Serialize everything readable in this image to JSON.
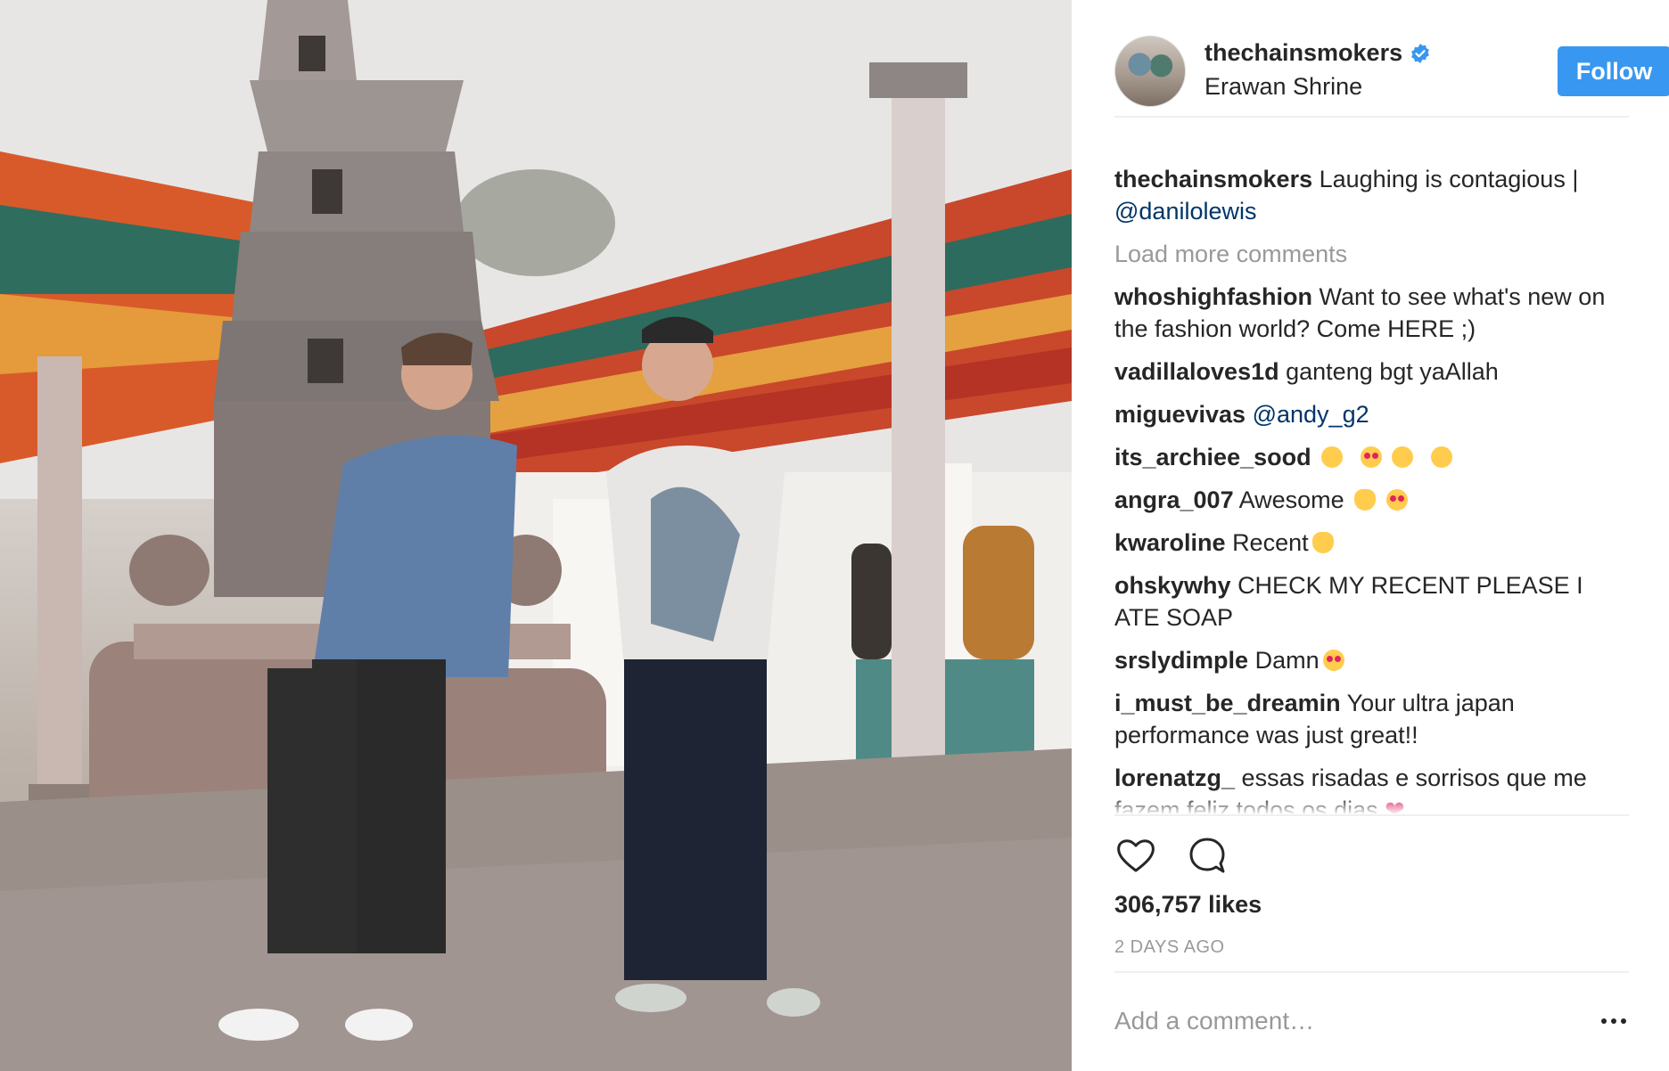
{
  "post": {
    "username": "thechainsmokers",
    "verified": true,
    "location": "Erawan Shrine",
    "follow_label": "Follow",
    "photo_alt": "",
    "accent_color": "#3897f0"
  },
  "caption": {
    "username": "thechainsmokers",
    "text": "Laughing is contagious |",
    "mention": "@danilolewis"
  },
  "load_more_label": "Load more comments",
  "comments": [
    {
      "username": "whoshighfashion",
      "text": "Want to see what's new on the fashion world? Come HERE ;)"
    },
    {
      "username": "vadillaloves1d",
      "text": "ganteng bgt yaAllah"
    },
    {
      "username": "miguevivas",
      "mention": "@andy_g2"
    },
    {
      "username": "its_archiee_sood",
      "text": "",
      "emojis": [
        "grinning-face",
        "heart-eyes-face",
        "kissing-face",
        "sweat-smile-face"
      ]
    },
    {
      "username": "angra_007",
      "text": "Awesome",
      "emojis": [
        "ok-hand",
        "heart-eyes-face"
      ]
    },
    {
      "username": "kwaroline",
      "text": "Recent",
      "emojis": [
        "ok-hand"
      ]
    },
    {
      "username": "ohskywhy",
      "text": "CHECK MY RECENT PLEASE I ATE SOAP"
    },
    {
      "username": "srslydimple",
      "text": "Damn",
      "emojis": [
        "heart-eyes-face"
      ]
    },
    {
      "username": "i_must_be_dreamin",
      "text": "Your ultra japan performance was just great!!"
    },
    {
      "username": "lorenatzg_",
      "text": "essas risadas e sorrisos que me fazem feliz todos os dias",
      "emojis": [
        "red-heart"
      ]
    }
  ],
  "actions": {
    "like_icon": "heart-outline-icon",
    "comment_icon": "speech-bubble-icon"
  },
  "likes_label": "306,757 likes",
  "timestamp": "2 DAYS AGO",
  "add_comment_placeholder": "Add a comment…",
  "more_options_icon": "ellipsis-icon"
}
